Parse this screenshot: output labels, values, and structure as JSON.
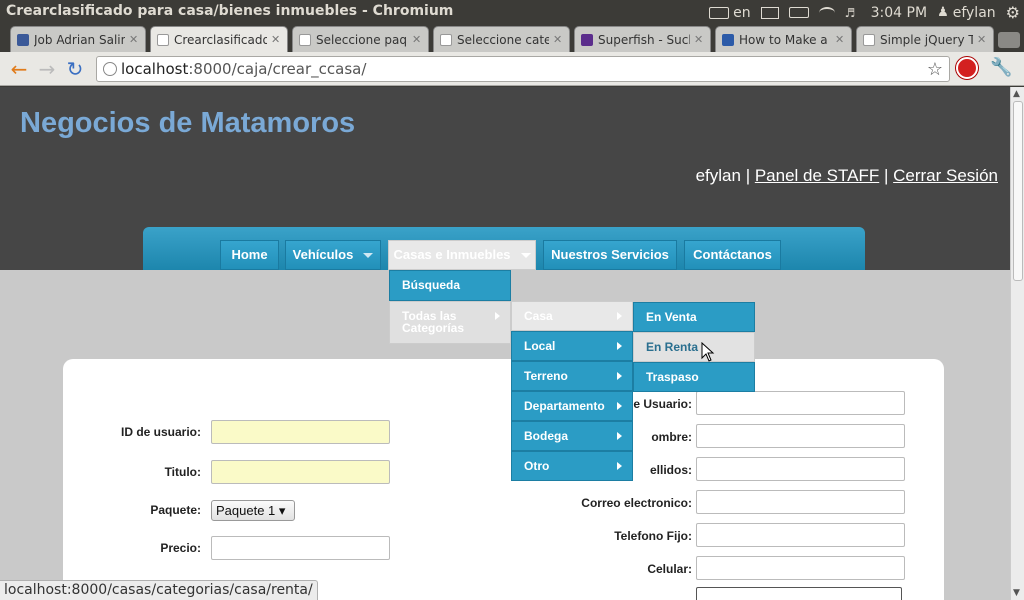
{
  "os": {
    "window_title": "Crearclasificado para casa/bienes inmuebles - Chromium",
    "keyboard_layout": "en",
    "clock": "3:04 PM",
    "user": "efylan"
  },
  "tabs": [
    {
      "label": "Job Adrian Salinas",
      "favicon_color": "#3b5998"
    },
    {
      "label": "Crearclasificado",
      "favicon_color": "#ffffff"
    },
    {
      "label": "Seleccione paque",
      "favicon_color": "#ffffff"
    },
    {
      "label": "Seleccione categ",
      "favicon_color": "#ffffff"
    },
    {
      "label": "Superfish - Sucke",
      "favicon_color": "#5b2d8c"
    },
    {
      "label": "How to Make a j",
      "favicon_color": "#2b5aa8"
    },
    {
      "label": "Simple jQuery Ta",
      "favicon_color": "#ffffff"
    }
  ],
  "address": {
    "host": "localhost",
    "path": ":8000/caja/crear_ccasa/"
  },
  "site": {
    "title": "Negocios de Matamoros",
    "username": "efylan",
    "sep1": " | ",
    "staff_link": "Panel de STAFF",
    "sep2": " | ",
    "logout_link": "Cerrar Sesión"
  },
  "nav": {
    "home": "Home",
    "vehiculos": "Vehículos",
    "casas": "Casas e Inmuebles",
    "servicios": "Nuestros Servicios",
    "contacto": "Contáctanos"
  },
  "menu_level1": {
    "busqueda": "Búsqueda",
    "todas": "Todas las Categorías"
  },
  "menu_level2": [
    "Casa",
    "Local",
    "Terreno",
    "Departamento",
    "Bodega",
    "Otro"
  ],
  "menu_level3": [
    "En Venta",
    "En Renta",
    "Traspaso"
  ],
  "form_left": {
    "id_label": "ID de usuario:",
    "titulo_label": "Titulo:",
    "paquete_label": "Paquete:",
    "paquete_value": "Paquete 1",
    "precio_label": "Precio:"
  },
  "form_right": {
    "usuario_label": "de Usuario:",
    "nombre_label": "ombre:",
    "apellidos_label": "ellidos:",
    "correo_label": "Correo electronico:",
    "telefono_label": "Telefono Fijo:",
    "celular_label": "Celular:"
  },
  "status_url": "localhost:8000/casas/categorias/casa/renta/"
}
